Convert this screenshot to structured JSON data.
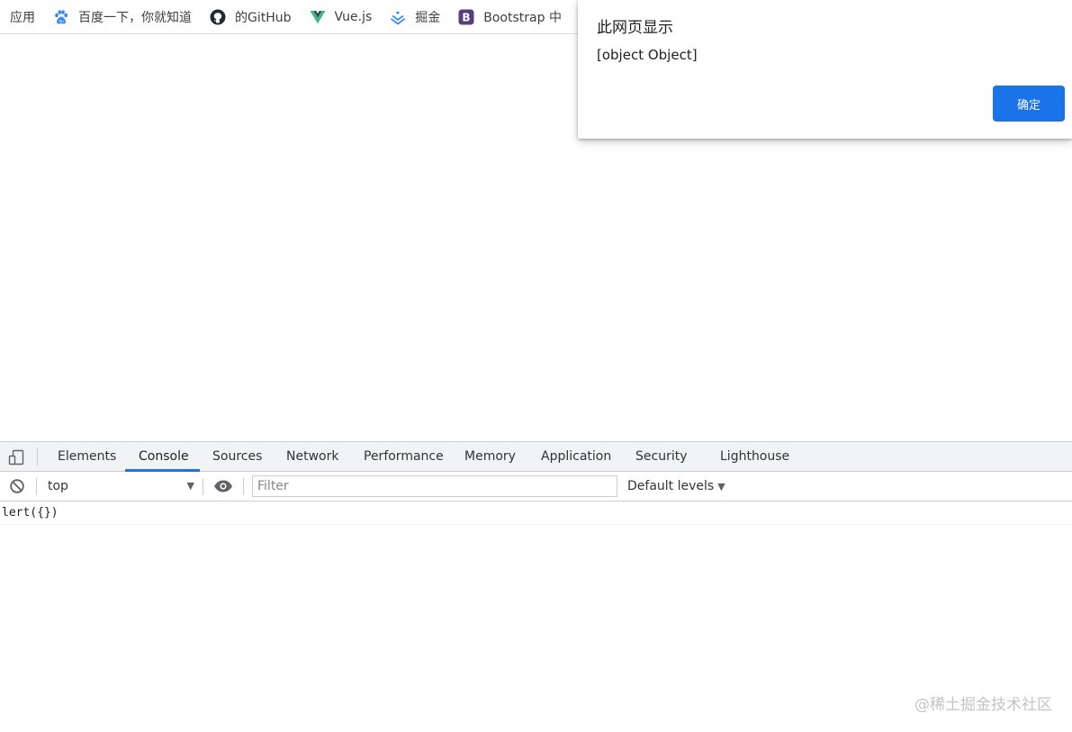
{
  "bookmarks": {
    "apps_label": "应用",
    "items": [
      {
        "label": "百度一下，你就知道",
        "icon": "baidu-paw-icon",
        "color": "#3385ff"
      },
      {
        "label": "的GitHub",
        "icon": "github-icon",
        "color": "#24292e"
      },
      {
        "label": "Vue.js",
        "icon": "vue-logo-icon",
        "color": "#41b883"
      },
      {
        "label": "掘金",
        "icon": "juejin-logo-icon",
        "color": "#1e80ff"
      },
      {
        "label": "Bootstrap 中",
        "icon": "bootstrap-logo-icon",
        "color": "#563d7c"
      }
    ]
  },
  "alert": {
    "title": "此网页显示",
    "message": "[object Object]",
    "ok_label": "确定",
    "accent": "#1a73e8"
  },
  "devtools": {
    "tabs": [
      {
        "label": "Elements",
        "active": false
      },
      {
        "label": "Console",
        "active": true
      },
      {
        "label": "Sources",
        "active": false
      },
      {
        "label": "Network",
        "active": false
      },
      {
        "label": "Performance",
        "active": false
      },
      {
        "label": "Memory",
        "active": false
      },
      {
        "label": "Application",
        "active": false
      },
      {
        "label": "Security",
        "active": false
      },
      {
        "label": "Lighthouse",
        "active": false
      }
    ],
    "toolbar": {
      "context": "top",
      "filter_placeholder": "Filter",
      "levels_label": "Default levels"
    },
    "console_lines": [
      "lert({})"
    ]
  },
  "watermark": "@稀土掘金技术社区"
}
